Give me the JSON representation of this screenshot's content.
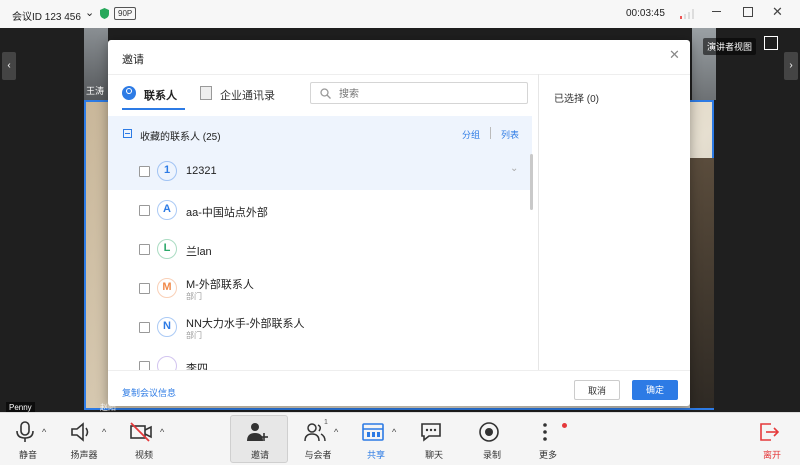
{
  "titlebar": {
    "meeting_id": "会议ID 123 456",
    "badge": "90P",
    "timer": "00:03:45"
  },
  "stage": {
    "participant_top_left": "王涛",
    "speaker_view_label": "演讲者视图",
    "participant_bottom_left": "Penny",
    "participant_bottom_mid": "赵阳"
  },
  "dialog": {
    "title": "邀请",
    "tabs": [
      {
        "label": "联系人",
        "icon": "contact-icon",
        "active": true
      },
      {
        "label": "企业通讯录",
        "icon": "directory-icon",
        "active": false
      }
    ],
    "search_placeholder": "搜索",
    "group": {
      "label": "收藏的联系人 (25)",
      "toggle_group": "分组",
      "toggle_list": "列表"
    },
    "contacts": [
      {
        "initial": "1",
        "name": "12321",
        "sub": "",
        "color": "#2d7be5",
        "highlighted": true
      },
      {
        "initial": "A",
        "name": "aa-中国站点外部",
        "sub": "",
        "color": "#2d7be5",
        "highlighted": false
      },
      {
        "initial": "L",
        "name": "兰lan",
        "sub": "",
        "color": "#2ca86a",
        "highlighted": false
      },
      {
        "initial": "M",
        "name": "M-外部联系人",
        "sub": "部门",
        "color": "#f0894a",
        "highlighted": false
      },
      {
        "initial": "N",
        "name": "NN大力水手-外部联系人",
        "sub": "部门",
        "color": "#2d7be5",
        "highlighted": false
      },
      {
        "initial": "",
        "name": "李四",
        "sub": "",
        "color": "#8e6bd8",
        "highlighted": false
      }
    ],
    "selected_label": "已选择 (0)",
    "copy_link": "复制会议信息",
    "cancel": "取消",
    "confirm": "确定"
  },
  "toolbar": [
    {
      "label": "静音",
      "icon": "microphone-icon",
      "caret": true
    },
    {
      "label": "扬声器",
      "icon": "speaker-icon",
      "caret": true
    },
    {
      "label": "视频",
      "icon": "video-off-icon",
      "caret": true
    },
    {
      "label": "邀请",
      "icon": "invite-icon",
      "caret": false
    },
    {
      "label": "与会者",
      "icon": "participants-icon",
      "caret": true,
      "count": "1"
    },
    {
      "label": "共享",
      "icon": "share-icon",
      "caret": true
    },
    {
      "label": "聊天",
      "icon": "chat-icon",
      "caret": false
    },
    {
      "label": "录制",
      "icon": "record-icon",
      "caret": false
    },
    {
      "label": "更多",
      "icon": "more-icon",
      "caret": false
    },
    {
      "label": "离开",
      "icon": "leave-icon",
      "caret": false
    }
  ],
  "colors": {
    "accent": "#2d7be5",
    "leave": "#e5393b",
    "highlight_row": "#eef4fd"
  }
}
